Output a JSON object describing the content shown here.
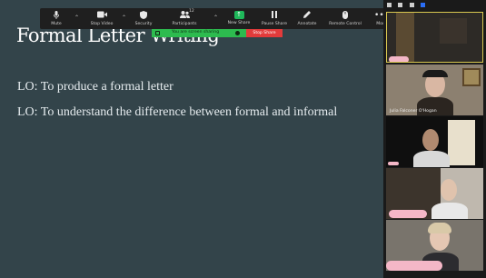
{
  "slide": {
    "title": "Formal Letter Writing",
    "lines": [
      "LO: To produce a formal letter",
      "LO: To understand the difference between formal and informal"
    ]
  },
  "toolbar": {
    "mute": "Mute",
    "stop_video": "Stop Video",
    "security": "Security",
    "participants": "Participants",
    "participant_count": "12",
    "new_share": "New Share",
    "pause_share": "Pause Share",
    "annotate": "Annotate",
    "remote_control": "Remote Control",
    "more": "More"
  },
  "share_bar": {
    "status": "You are screen sharing",
    "stop_label": "Stop Share"
  },
  "gallery": {
    "tiles": [
      {
        "name": ""
      },
      {
        "name": "Julia Falconer O'Hogan"
      },
      {
        "name": ""
      },
      {
        "name": ""
      },
      {
        "name": ""
      }
    ]
  },
  "colors": {
    "slide_bg": "#33444a",
    "share_green": "#2dbb4f",
    "stop_red": "#e23b3b",
    "active_speaker": "#d9c850"
  },
  "icons": {
    "mute": "microphone-icon",
    "stop_video": "video-camera-icon",
    "security": "shield-icon",
    "participants": "people-icon",
    "new_share": "arrow-up-icon",
    "pause_share": "pause-icon",
    "annotate": "pencil-icon",
    "remote_control": "mouse-icon",
    "more": "more-icon"
  }
}
